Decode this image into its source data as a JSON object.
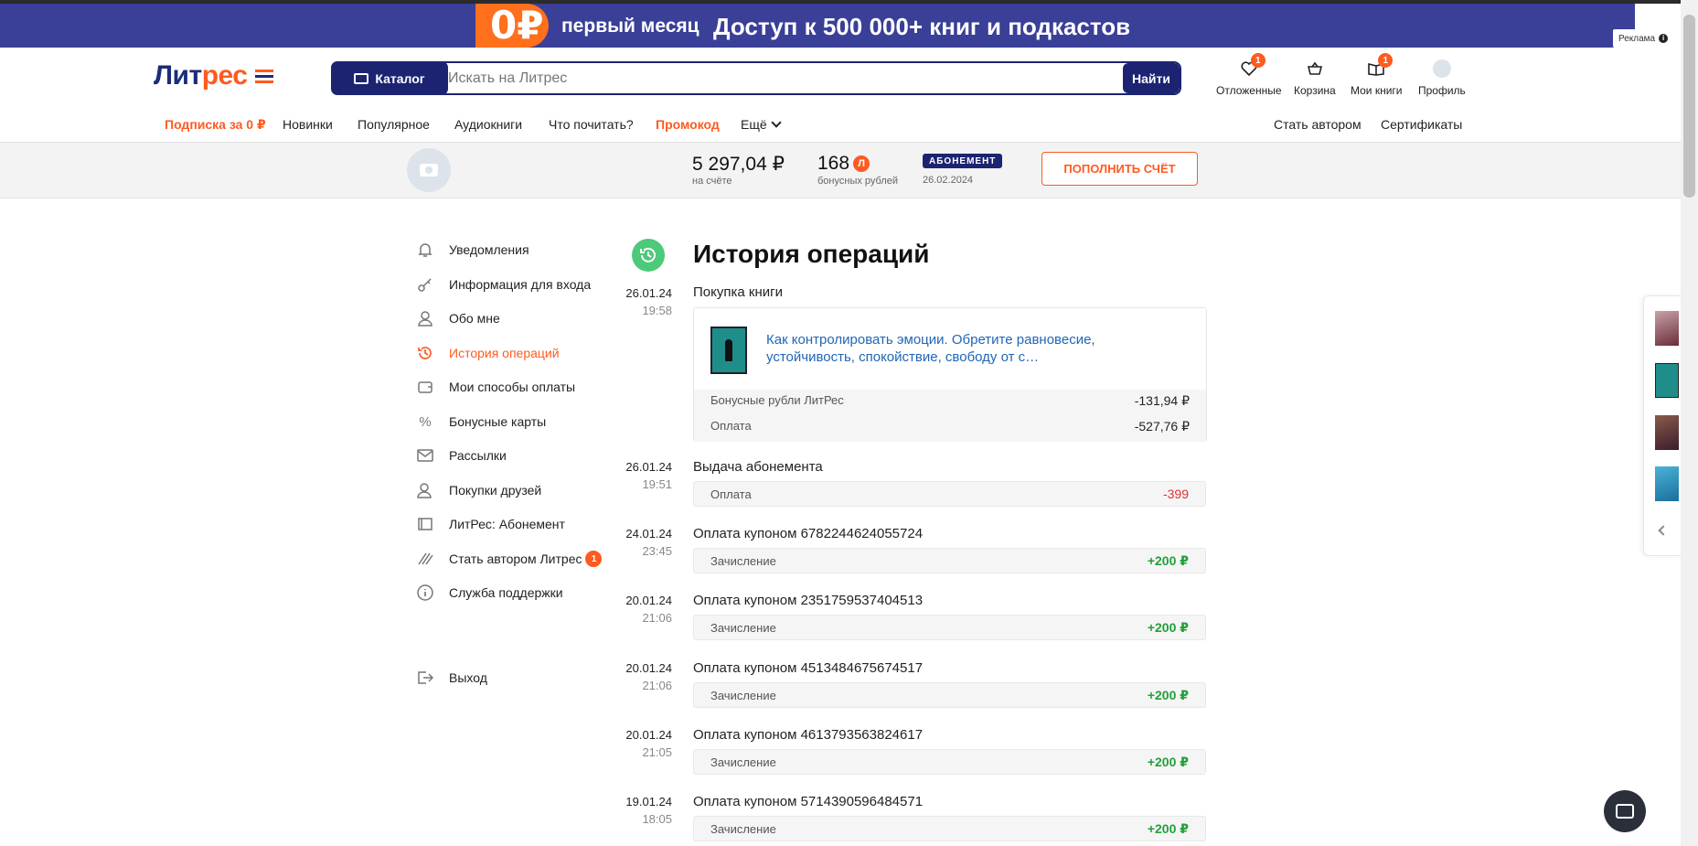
{
  "ad": {
    "price": "0₽",
    "sub": "первый месяц",
    "main": "Доступ к 500 000+ книг и подкастов",
    "label": "Реклама"
  },
  "header": {
    "logo_main": "Лит",
    "logo_accent": "рес",
    "catalog_label": "Каталог",
    "search_placeholder": "Искать на Литрес",
    "search_button": "Найти",
    "icons": [
      {
        "label": "Отложенные",
        "badge": "1"
      },
      {
        "label": "Корзина"
      },
      {
        "label": "Мои книги",
        "badge": "1"
      },
      {
        "label": "Профиль"
      }
    ],
    "nav": [
      "Подписка за 0 ₽",
      "Новинки",
      "Популярное",
      "Аудиокниги",
      "Что почитать?",
      "Промокод",
      "Ещё"
    ],
    "nav_right": [
      "Стать автором",
      "Сертификаты"
    ]
  },
  "account": {
    "balance": "5 297,04 ₽",
    "balance_label": "на счёте",
    "bonus": "168",
    "bonus_badge": "Л",
    "bonus_label": "бонусных рублей",
    "subscription_badge": "АБОНЕМЕНТ",
    "subscription_date": "26.02.2024",
    "topup_label": "ПОПОЛНИТЬ СЧЁТ"
  },
  "menu": {
    "items": [
      {
        "label": "Уведомления"
      },
      {
        "label": "Информация для входа"
      },
      {
        "label": "Обо мне"
      },
      {
        "label": "История операций"
      },
      {
        "label": "Мои способы оплаты"
      },
      {
        "label": "Бонусные карты"
      },
      {
        "label": "Рассылки"
      },
      {
        "label": "Покупки друзей"
      },
      {
        "label": "ЛитРес: Абонемент"
      },
      {
        "label": "Стать автором Литрес",
        "badge": "1"
      },
      {
        "label": "Служба поддержки"
      }
    ],
    "logout": "Выход"
  },
  "history": {
    "title": "История операций",
    "operations": [
      {
        "date": "26.01.24",
        "time": "19:58",
        "title": "Покупка книги",
        "book": "Как контролировать эмоции. Обретите равновесие, устойчивость, спокойствие, свободу от с…",
        "rows": [
          {
            "label": "Бонусные рубли ЛитРес",
            "amount": "-131,94 ₽"
          },
          {
            "label": "Оплата",
            "amount": "-527,76 ₽"
          }
        ]
      },
      {
        "date": "26.01.24",
        "time": "19:51",
        "title": "Выдача абонемента",
        "row_label": "Оплата",
        "amount": "-399"
      },
      {
        "date": "24.01.24",
        "time": "23:45",
        "title": "Оплата купоном 6782244624055724",
        "row_label": "Зачисление",
        "amount": "+200 ₽"
      },
      {
        "date": "20.01.24",
        "time": "21:06",
        "title": "Оплата купоном 2351759537404513",
        "row_label": "Зачисление",
        "amount": "+200 ₽"
      },
      {
        "date": "20.01.24",
        "time": "21:06",
        "title": "Оплата купоном 4513484675674517",
        "row_label": "Зачисление",
        "amount": "+200 ₽"
      },
      {
        "date": "20.01.24",
        "time": "21:05",
        "title": "Оплата купоном 4613793563824617",
        "row_label": "Зачисление",
        "amount": "+200 ₽"
      },
      {
        "date": "19.01.24",
        "time": "18:05",
        "title": "Оплата купоном 5714390596484571",
        "row_label": "Зачисление",
        "amount": "+200 ₽"
      }
    ]
  },
  "colors": {
    "brand_navy": "#1c2472",
    "accent_orange": "#ff5a1f",
    "credit_green": "#23a03a",
    "debit_red": "#dd3333"
  }
}
